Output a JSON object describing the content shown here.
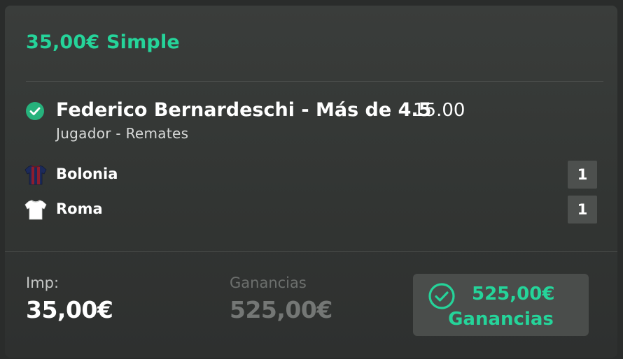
{
  "bet": {
    "header": "35,00€ Simple",
    "selection": "Federico Bernardeschi - Más de 4.5",
    "odds": "15.00",
    "market": "Jugador - Remates",
    "status_icon": "check-circle-icon",
    "teams": [
      {
        "name": "Bolonia",
        "score": "1",
        "jersey_icon": "jersey-icon",
        "colors": [
          "#1a2a5c",
          "#8c1c2c"
        ]
      },
      {
        "name": "Roma",
        "score": "1",
        "jersey_icon": "jersey-icon",
        "colors": [
          "#ffffff"
        ]
      }
    ]
  },
  "summary": {
    "stake_label": "Imp:",
    "stake_value": "35,00€",
    "returns_label": "Ganancias",
    "returns_value": "525,00€",
    "winnings_amount": "525,00€",
    "winnings_label": "Ganancias",
    "winnings_icon": "check-circle-outline-icon"
  },
  "colors": {
    "accent": "#25d49a",
    "success_icon": "#26b27c",
    "background": "#2a2c2b",
    "card": "#363937"
  }
}
